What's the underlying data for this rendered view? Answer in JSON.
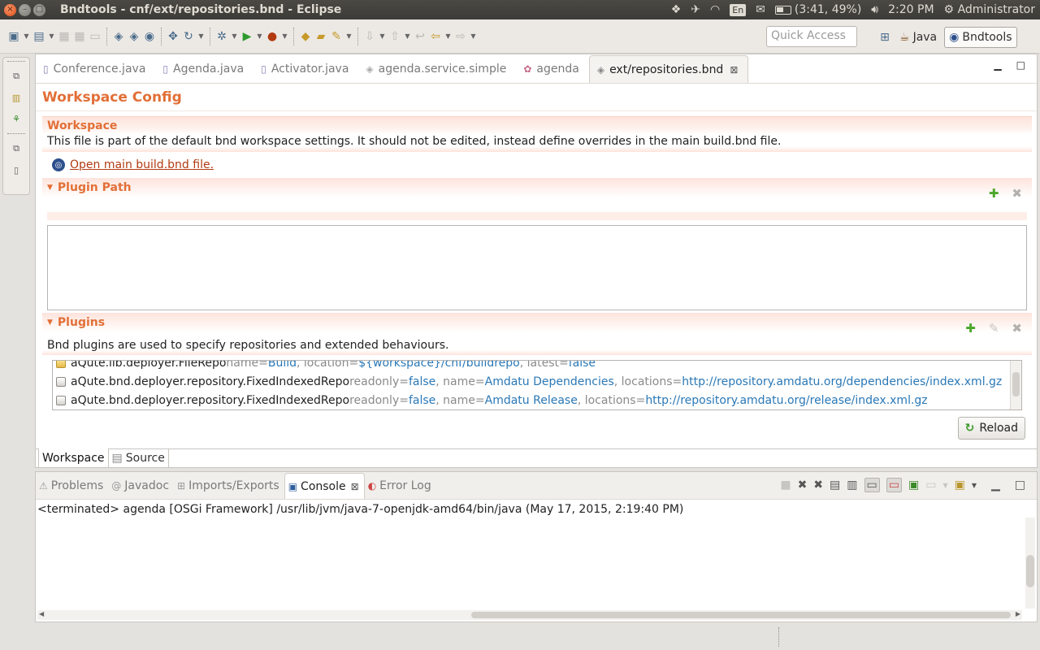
{
  "window": {
    "title": "Bndtools - cnf/ext/repositories.bnd - Eclipse",
    "buttons": [
      "×",
      "–",
      "□"
    ]
  },
  "indicators": {
    "lang": "En",
    "battery": "(3:41, 49%)",
    "time": "2:20 PM",
    "user": "Administrator"
  },
  "toolbar": {
    "quick_access_placeholder": "Quick Access",
    "perspectives": [
      {
        "label": "Java",
        "active": false
      },
      {
        "label": "Bndtools",
        "active": true
      }
    ]
  },
  "editor": {
    "tabs": [
      {
        "label": "Conference.java",
        "icon": "java-file-icon",
        "active": false
      },
      {
        "label": "Agenda.java",
        "icon": "java-file-icon",
        "active": false
      },
      {
        "label": "Activator.java",
        "icon": "java-file-icon",
        "active": false
      },
      {
        "label": "agenda.service.simple",
        "icon": "bnd-file-icon",
        "active": false
      },
      {
        "label": "agenda",
        "icon": "bundle-icon",
        "active": false
      },
      {
        "label": "ext/repositories.bnd",
        "icon": "bnd-file-icon",
        "active": true
      }
    ],
    "form_title": "Workspace Config",
    "workspace": {
      "heading": "Workspace",
      "description": "This file is part of the default bnd workspace settings. It should not be edited, instead define overrides in the main build.bnd file.",
      "link": "Open main build.bnd file."
    },
    "plugin_path": {
      "heading": "Plugin Path"
    },
    "plugins": {
      "heading": "Plugins",
      "description": "Bnd plugins are used to specify repositories and extended behaviours.",
      "rows": [
        {
          "cls": "aQute.lib.deployer.FileRepo",
          "k1": " name=",
          "v1": "Build",
          "k2": ", location=",
          "v2": "${workspace}/cnf/buildrepo",
          "k3": ", latest=",
          "v3": "false"
        },
        {
          "cls": "aQute.bnd.deployer.repository.FixedIndexedRepo",
          "k1": " readonly=",
          "v1": "false",
          "k2": ", name=",
          "v2": "Amdatu Dependencies",
          "k3": ", locations=",
          "v3": "http://repository.amdatu.org/dependencies/index.xml.gz"
        },
        {
          "cls": "aQute.bnd.deployer.repository.FixedIndexedRepo",
          "k1": " readonly=",
          "v1": "false",
          "k2": ", name=",
          "v2": "Amdatu Release",
          "k3": ", locations=",
          "v3": "http://repository.amdatu.org/release/index.xml.gz"
        }
      ],
      "reload_label": "Reload"
    },
    "page_tabs": [
      {
        "label": "Workspace",
        "active": true
      },
      {
        "label": "Source",
        "active": false
      }
    ]
  },
  "console": {
    "tabs": [
      {
        "label": "Problems",
        "icon": "problems-icon",
        "active": false
      },
      {
        "label": "Javadoc",
        "icon": "javadoc-icon",
        "active": false
      },
      {
        "label": "Imports/Exports",
        "icon": "imports-exports-icon",
        "active": false
      },
      {
        "label": "Console",
        "icon": "console-icon",
        "active": true
      },
      {
        "label": "Error Log",
        "icon": "error-log-icon",
        "active": false
      }
    ],
    "process": "<terminated> agenda [OSGi Framework] /usr/lib/jvm/java-7-openjdk-amd64/bin/java (May 17, 2015, 2:19:40 PM)"
  }
}
